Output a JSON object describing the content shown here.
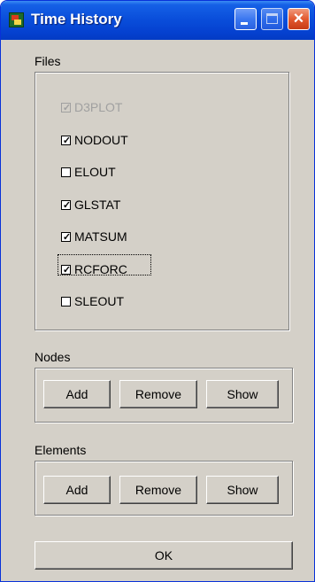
{
  "window": {
    "title": "Time History"
  },
  "files": {
    "label": "Files",
    "items": [
      {
        "label": "D3PLOT",
        "checked": true,
        "disabled": true
      },
      {
        "label": "NODOUT",
        "checked": true,
        "disabled": false
      },
      {
        "label": "ELOUT",
        "checked": false,
        "disabled": false
      },
      {
        "label": "GLSTAT",
        "checked": true,
        "disabled": false
      },
      {
        "label": "MATSUM",
        "checked": true,
        "disabled": false
      },
      {
        "label": "RCFORC",
        "checked": true,
        "disabled": false
      },
      {
        "label": "SLEOUT",
        "checked": false,
        "disabled": false
      }
    ]
  },
  "nodes": {
    "label": "Nodes",
    "add": "Add",
    "remove": "Remove",
    "show": "Show"
  },
  "elements": {
    "label": "Elements",
    "add": "Add",
    "remove": "Remove",
    "show": "Show"
  },
  "ok_label": "OK",
  "check_glyph": "✓"
}
